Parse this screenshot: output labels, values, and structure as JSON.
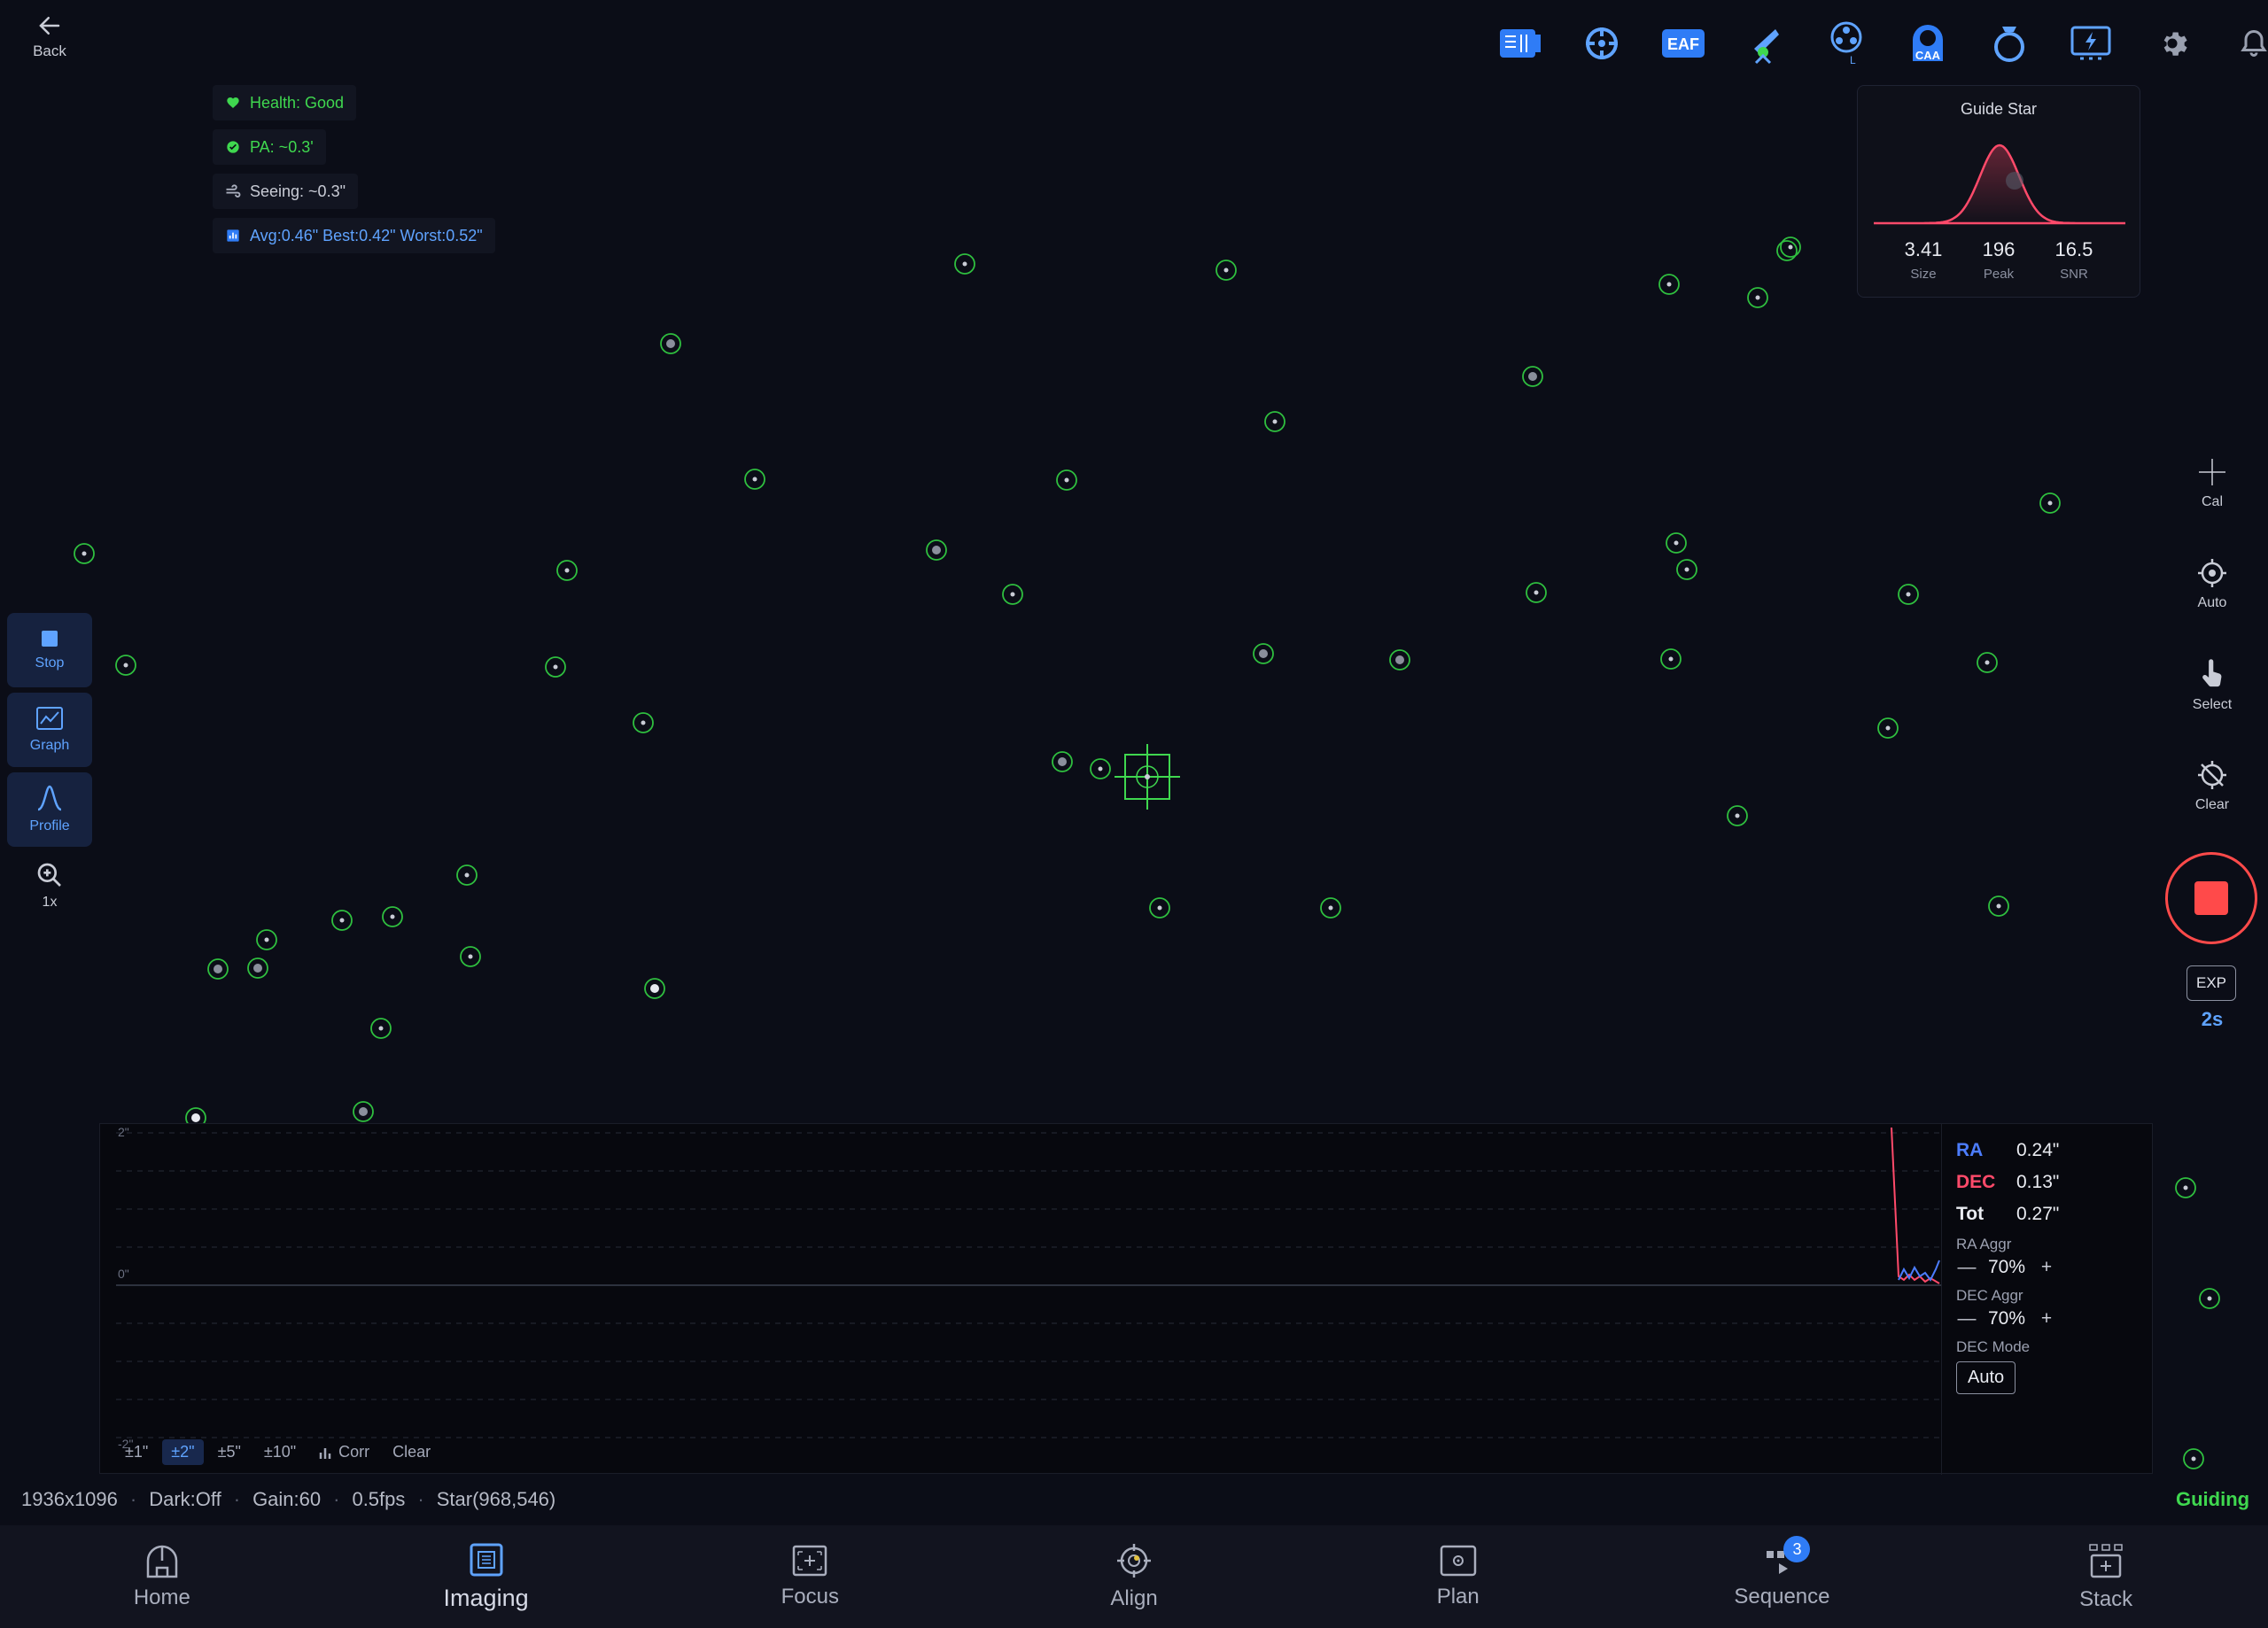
{
  "back": {
    "label": "Back"
  },
  "badges": {
    "health": "Health: Good",
    "pa": "PA: ~0.3'",
    "seeing": "Seeing: ~0.3\"",
    "stats": "Avg:0.46\" Best:0.42\" Worst:0.52\""
  },
  "toolbar": {
    "icons": [
      "camera-icon",
      "guider-icon",
      "eaf-icon",
      "mount-icon",
      "filter-wheel-icon",
      "caa-icon",
      "ring-icon",
      "power-icon",
      "settings-icon",
      "bell-icon"
    ],
    "eaf_text": "EAF",
    "caa_text": "CAA"
  },
  "guide_star": {
    "title": "Guide Star",
    "size": "3.41",
    "size_label": "Size",
    "peak": "196",
    "peak_label": "Peak",
    "snr": "16.5",
    "snr_label": "SNR"
  },
  "left_tools": {
    "stop": "Stop",
    "graph": "Graph",
    "profile": "Profile",
    "zoom": "1x"
  },
  "right_tools": {
    "cal": "Cal",
    "auto": "Auto",
    "select": "Select",
    "clear": "Clear",
    "exp_label": "EXP",
    "exp_value": "2s"
  },
  "graph": {
    "y_top": "2\"",
    "y_mid": "0\"",
    "y_bottom": "-2\"",
    "ra_label": "RA",
    "ra_value": "0.24\"",
    "dec_label": "DEC",
    "dec_value": "0.13\"",
    "tot_label": "Tot",
    "tot_value": "0.27\"",
    "ra_aggr_label": "RA Aggr",
    "ra_aggr_value": "70%",
    "dec_aggr_label": "DEC Aggr",
    "dec_aggr_value": "70%",
    "dec_mode_label": "DEC Mode",
    "dec_mode_value": "Auto",
    "ranges": [
      "±1\"",
      "±2\"",
      "±5\"",
      "±10\""
    ],
    "active_range": 1,
    "corr": "Corr",
    "clear": "Clear",
    "colors": {
      "ra": "#4c7dff",
      "dec": "#ff4a6a"
    }
  },
  "status": {
    "resolution": "1936x1096",
    "dark": "Dark:Off",
    "gain": "Gain:60",
    "fps": "0.5fps",
    "star": "Star(968,546)",
    "state": "Guiding"
  },
  "nav": {
    "home": "Home",
    "imaging": "Imaging",
    "focus": "Focus",
    "align": "Align",
    "plan": "Plan",
    "sequence": "Sequence",
    "sequence_badge": "3",
    "stack": "Stack"
  },
  "colors": {
    "accent": "#5fa3ff",
    "star_ring": "#3fd74f",
    "record": "#ff4a4a"
  }
}
